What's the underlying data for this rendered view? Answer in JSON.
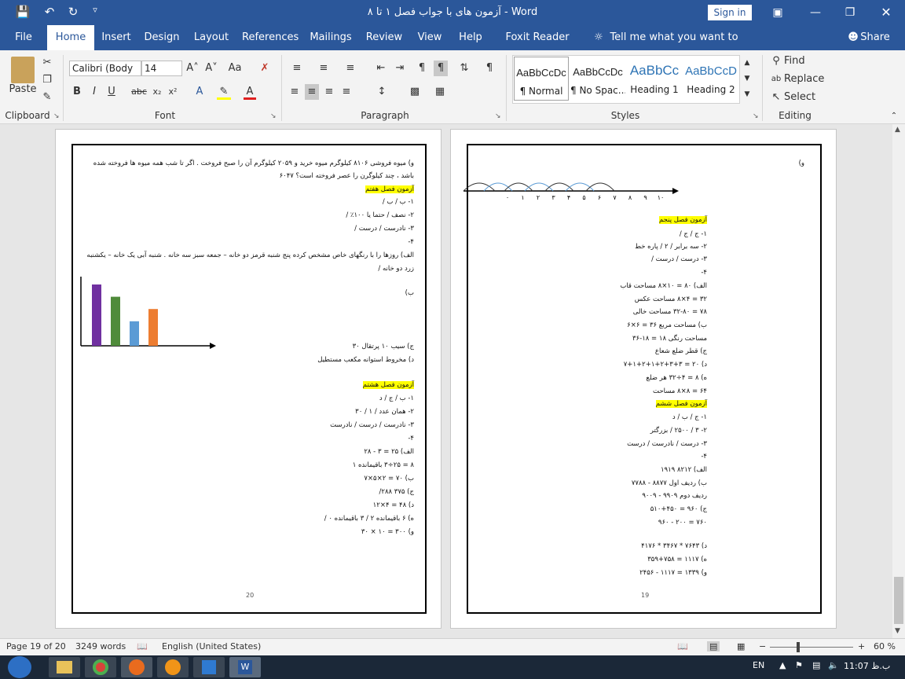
{
  "window": {
    "title": "آزمون های با جواب فصل ۱ تا ۸ - Word",
    "sign_in": "Sign in"
  },
  "tabs": [
    "File",
    "Home",
    "Insert",
    "Design",
    "Layout",
    "References",
    "Mailings",
    "Review",
    "View",
    "Help",
    "Foxit Reader PDF",
    "Tell me what you want to do",
    "Share"
  ],
  "ribbon": {
    "clipboard": {
      "label": "Clipboard",
      "paste": "Paste"
    },
    "font": {
      "label": "Font",
      "family": "Calibri (Body",
      "size": "14"
    },
    "paragraph": {
      "label": "Paragraph"
    },
    "styles": {
      "label": "Styles",
      "items": [
        {
          "sample": "AaBbCcDc",
          "name": "¶ Normal"
        },
        {
          "sample": "AaBbCcDc",
          "name": "¶ No Spac..."
        },
        {
          "sample": "AaBbCc",
          "name": "Heading 1"
        },
        {
          "sample": "AaBbCcD",
          "name": "Heading 2"
        }
      ]
    },
    "editing": {
      "label": "Editing",
      "find": "Find",
      "replace": "Replace",
      "select": "Select"
    }
  },
  "pages": {
    "left": {
      "number": "20",
      "lines": [
        "و) میوه فروشی ۸۱۰۶ کیلوگرم میوه خرید و ۲۰۵۹ کیلوگرم آن را صبح فروخت . اگر تا شب همه میوه ها فروخته شده",
        "باشد ، چند کیلوگرن را عصر فروخته است؟       ۶۰۴۷",
        "آزمون فصل هفتم",
        "۱-  ب / ب /",
        "۲-  نصف / حتما یا ۱۰۰٪  /",
        "۳-  نادرست / درست  /",
        "۴-",
        "الف) روزها را با رنگهای خاص مشخص کرده پنج شنبه قرمز دو خانه – جمعه سبز سه خانه . شنبه آبی یک خانه – یکشنبه",
        "زرد دو خانه /",
        "ب)",
        "ج) سیب ۱۰  پرتقال ۳۰",
        "د) مخروط  استوانه  مکعب مستطیل",
        "آزمون فصل هشتم",
        "۱-  ب / ج / د",
        "۲-  همان عدد / ۱  /  ۳۰",
        "۳-  نادرست / درست  / نادرست",
        "۴-",
        "الف) ۲۵ = ۳ - ۲۸",
        "۸ = ۲۵÷۳  باقیمانده ۱",
        "ب)  ۷۰ = ۲×۵×۷",
        "ج)  ۳۷۵  ۲۸۸/",
        "د)  ۴۸ = ۴×۱۲",
        "ه)  ۶ باقیمانده ۲  /  ۳ باقیمانده ۰  /",
        "و)  ۳۰۰ = ۱۰ × ۳۰"
      ],
      "chart_data": {
        "type": "bar",
        "values": [
          5,
          4,
          2,
          3
        ],
        "colors": [
          "#7030a0",
          "#4f8b3a",
          "#5b9bd5",
          "#ed7d31"
        ]
      }
    },
    "right": {
      "number": "19",
      "numberline": [
        "۰",
        "۱",
        "۲",
        "۳",
        "۴",
        "۵",
        "۶",
        "۷",
        "۸",
        "۹",
        "۱۰"
      ],
      "lines": [
        "و)",
        "آزمون فصل پنجم",
        "۱-  ج / ج /",
        "۲-  سه برابر / ۲  /  پاره خط",
        "۳-  درست / درست  /",
        "۴-",
        "الف) ۸۰ = ۱۰×۸  مساحت قاب",
        "۳۲ = ۴×۸  مساحت عکس",
        "۷۸ = ۳۲-۸۰  مساحت خالی",
        "ب)  مساحت مربع  ۳۶ = ۶×۶",
        "مساحت رنگی  ۱۸ = ۱۸-۳۶",
        "ج)  قطر  ضلع  شعاع",
        "د)  ۲۰ = ۳+۳+۲+۱+۲+۱+۷",
        "ه)  ۸ = ۴÷۳۲  هر ضلع",
        "۶۴ = ۸×۸  مساحت",
        "آزمون فصل ششم",
        "۱-  ج / ب / د",
        "۲-  ۳ / ۲۵۰۰ /  بزرگتر",
        "۳-  درست / نادرست  / درست",
        "۴-",
        "الف) ۸۲۱۲  ۱۹۱۹",
        "ب)  ردیف اول  ۸۸۷۷ - ۷۷۸۸",
        "ردیف دوم  ۹۹۰۹ - ۹۰۰۹",
        "ج)  ۹۶۰ = ۴۵۰+۵۱۰",
        "۷۶۰ = ۲۰۰ - ۹۶۰",
        "د)  ۷۶۴۳  *  ۳۴۶۷  *  ۴۱۷۶",
        "ه)  ۱۱۱۷ = ۷۵۸+۳۵۹",
        "و)  ۱۳۳۹ = ۱۱۱۷ - ۲۴۵۶"
      ]
    }
  },
  "status": {
    "page": "Page 19 of 20",
    "words": "3249 words",
    "language": "English (United States)",
    "zoom": "60 %"
  },
  "taskbar": {
    "lang": "EN",
    "time": "ب.ظ 11:07"
  }
}
